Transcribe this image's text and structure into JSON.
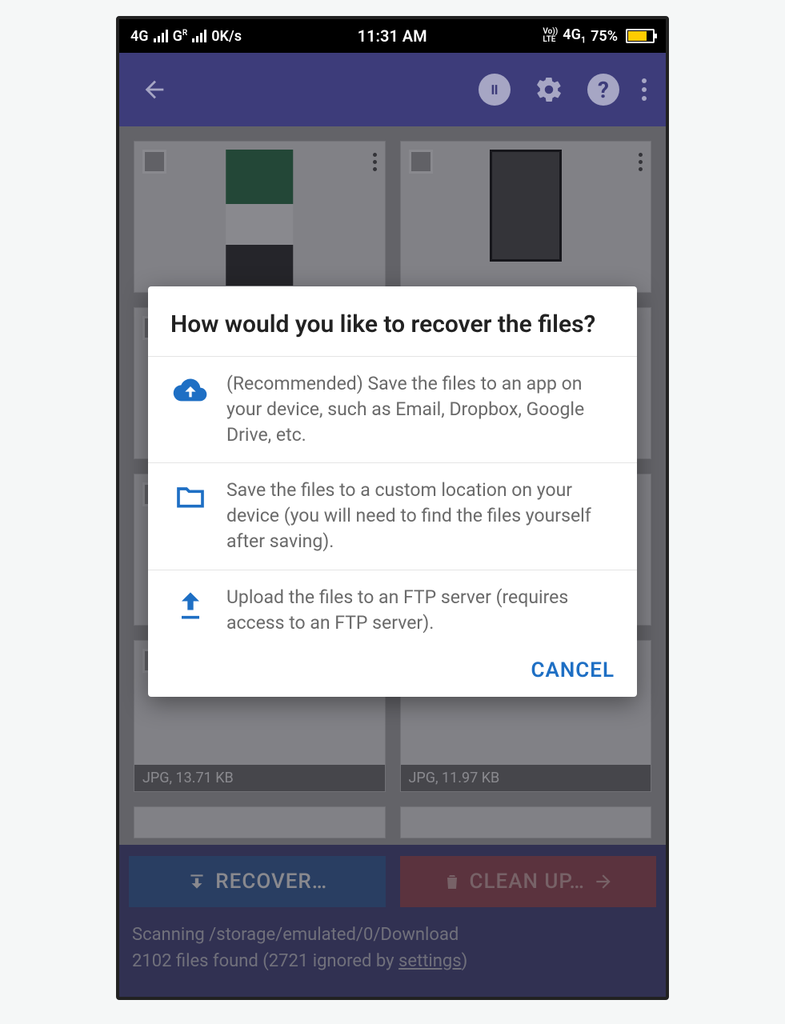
{
  "status_bar": {
    "net1": "4G",
    "net2": "G",
    "net2_sup": "R",
    "speed": "0K/s",
    "time": "11:31 AM",
    "right_small_top": "Vo))",
    "right_small_bot": "LTE",
    "right_4g": "4G",
    "right_sub": "1",
    "battery": "75%"
  },
  "cards": [
    {
      "label": ""
    },
    {
      "label": ""
    },
    {
      "label": "JPG, 13.71 KB"
    },
    {
      "label": "JPG, 11.97 KB"
    }
  ],
  "dialog": {
    "title": "How would you like to recover the files?",
    "options": [
      {
        "text": "(Recommended) Save the files to an app on your device, such as Email, Dropbox, Google Drive, etc."
      },
      {
        "text": "Save the files to a custom location on your device (you will need to find the files yourself after saving)."
      },
      {
        "text": "Upload the files to an FTP server (requires access to an FTP server)."
      }
    ],
    "cancel": "CANCEL"
  },
  "bottom": {
    "recover": "RECOVER…",
    "cleanup": "CLEAN UP…",
    "status_line1": "Scanning /storage/emulated/0/Download",
    "status_line2a": "2102 files found (2721 ignored by ",
    "status_line2b": "settings",
    "status_line2c": ")"
  }
}
